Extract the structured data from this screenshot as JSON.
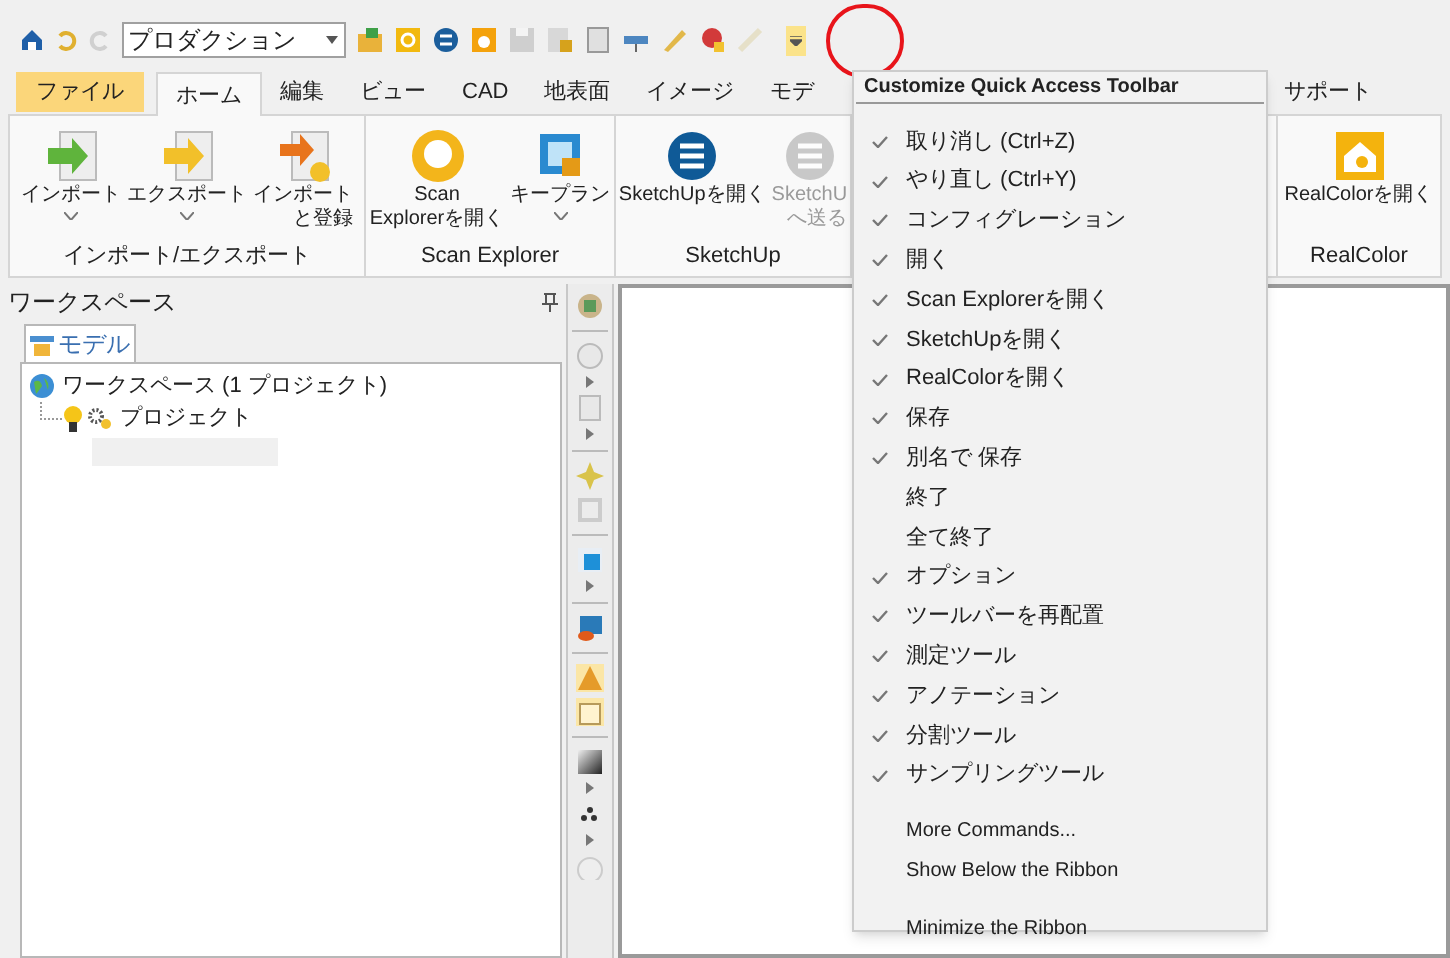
{
  "quick_access": {
    "combo_value": "プロダクション"
  },
  "tabs": [
    {
      "label": "ファイル",
      "kind": "file",
      "selected": false
    },
    {
      "label": "ホーム",
      "kind": "tab",
      "selected": true
    },
    {
      "label": "編集",
      "kind": "tab",
      "selected": false
    },
    {
      "label": "ビュー",
      "kind": "tab",
      "selected": false
    },
    {
      "label": "CAD",
      "kind": "tab",
      "selected": false
    },
    {
      "label": "地表面",
      "kind": "tab",
      "selected": false
    },
    {
      "label": "イメージ",
      "kind": "tab",
      "selected": false
    },
    {
      "label": "モデ",
      "kind": "tab",
      "selected": false
    },
    {
      "label": "サポート",
      "kind": "tab",
      "selected": false
    }
  ],
  "ribbon": {
    "groups": [
      {
        "label": "インポート/エクスポート",
        "buttons": [
          {
            "lines": [
              "インポート"
            ],
            "dropdown": true,
            "disabled": false
          },
          {
            "lines": [
              "エクスポート"
            ],
            "dropdown": true,
            "disabled": false
          },
          {
            "lines": [
              "インポート",
              "と登録"
            ],
            "dropdown": false,
            "disabled": false
          }
        ]
      },
      {
        "label": "Scan Explorer",
        "buttons": [
          {
            "lines": [
              "Scan",
              "Explorerを開く"
            ],
            "dropdown": false,
            "disabled": false
          },
          {
            "lines": [
              "キープラン"
            ],
            "dropdown": true,
            "disabled": false
          }
        ]
      },
      {
        "label": "SketchUp",
        "buttons": [
          {
            "lines": [
              "SketchUpを開く"
            ],
            "dropdown": false,
            "disabled": false
          },
          {
            "lines": [
              "SketchU",
              "へ送る"
            ],
            "dropdown": false,
            "disabled": true
          }
        ]
      },
      {
        "label": "RealColor",
        "buttons": [
          {
            "lines": [
              "RealColorを開く"
            ],
            "dropdown": false,
            "disabled": false
          }
        ]
      }
    ]
  },
  "workspace": {
    "title": "ワークスペース",
    "tab": "モデル",
    "tree": [
      {
        "label": "ワークスペース (1 プロジェクト)",
        "children": [
          {
            "label": "プロジェクト"
          }
        ]
      }
    ]
  },
  "menu": {
    "title": "Customize Quick Access Toolbar",
    "items": [
      {
        "label": "取り消し (Ctrl+Z)",
        "checked": true
      },
      {
        "label": "やり直し (Ctrl+Y)",
        "checked": true
      },
      {
        "label": "コンフィグレーション",
        "checked": true
      },
      {
        "label": "開く",
        "checked": true
      },
      {
        "label": "Scan Explorerを開く",
        "checked": true
      },
      {
        "label": "SketchUpを開く",
        "checked": true
      },
      {
        "label": "RealColorを開く",
        "checked": true
      },
      {
        "label": "保存",
        "checked": true
      },
      {
        "label": "別名で 保存",
        "checked": true
      },
      {
        "label": "終了",
        "checked": false
      },
      {
        "label": "全て終了",
        "checked": false
      },
      {
        "label": "オプション",
        "checked": true
      },
      {
        "label": "ツールバーを再配置",
        "checked": true
      },
      {
        "label": "測定ツール",
        "checked": true
      },
      {
        "label": "アノテーション",
        "checked": true
      },
      {
        "label": "分割ツール",
        "checked": true
      },
      {
        "label": "サンプリングツール",
        "checked": true
      }
    ],
    "commands": [
      [
        "More Commands...",
        "Show Below the Ribbon"
      ],
      [
        "Minimize the Ribbon"
      ]
    ]
  }
}
